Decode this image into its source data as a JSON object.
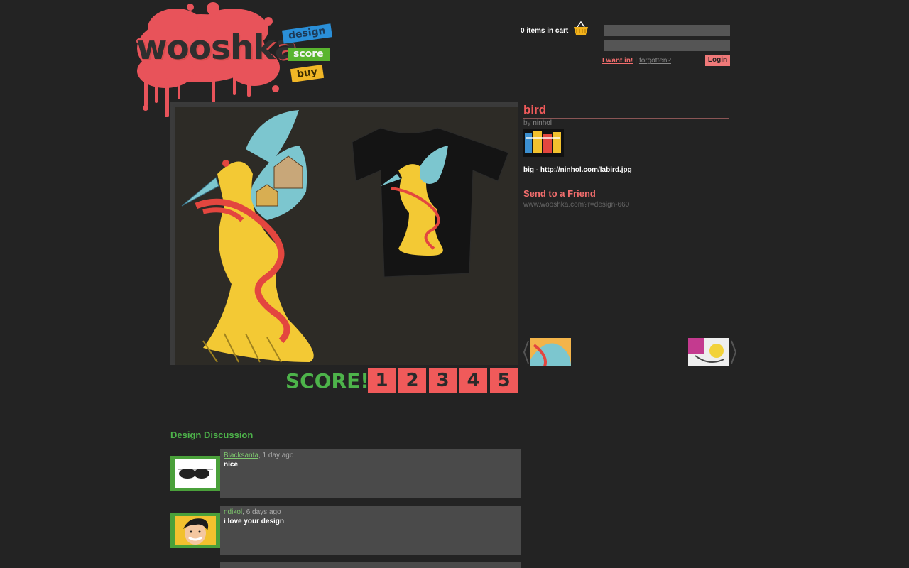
{
  "brand": {
    "name": "wooshka",
    "tags": {
      "design": "design",
      "score": "score",
      "buy": "buy"
    },
    "colors": {
      "splash": "#e8535a",
      "design_tag": "#2a8fd8",
      "score_tag": "#5ab52f",
      "buy_tag": "#f1b626"
    }
  },
  "header": {
    "cart_text": "0 items in cart",
    "want_in_label": "I want in!",
    "separator": "|",
    "forgotten_label": "forgotten?",
    "login_label": "Login",
    "username_value": "",
    "password_value": ""
  },
  "design": {
    "title": "bird",
    "by_prefix": "by",
    "author": "ninhol",
    "big_link": "big - http://ninhol.com/labird.jpg",
    "send_title": "Send to a Friend",
    "share_url": "www.wooshka.com?r=design-660"
  },
  "score": {
    "label": "SCORE!",
    "options": [
      "1",
      "2",
      "3",
      "4",
      "5"
    ],
    "accent": "#f05a5a"
  },
  "discussion": {
    "title": "Design Discussion",
    "comments": [
      {
        "author": "Blacksanta",
        "time": ", 1 day ago",
        "text": "nice",
        "avatar": "sunglasses-avatar"
      },
      {
        "author": "ndikol",
        "time": ", 6 days ago",
        "text": "i love your design",
        "avatar": "cartoon-face-avatar"
      }
    ]
  },
  "icons": {
    "cart": "basket-icon",
    "prev": "chevron-left-icon",
    "next": "chevron-right-icon"
  }
}
